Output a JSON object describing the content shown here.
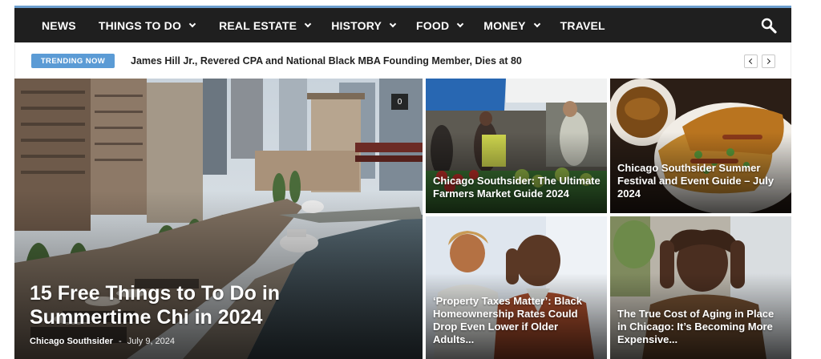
{
  "nav": {
    "items": [
      {
        "label": "NEWS",
        "dropdown": false
      },
      {
        "label": "THINGS TO DO",
        "dropdown": true
      },
      {
        "label": "REAL ESTATE",
        "dropdown": true
      },
      {
        "label": "HISTORY",
        "dropdown": true
      },
      {
        "label": "FOOD",
        "dropdown": true
      },
      {
        "label": "MONEY",
        "dropdown": true
      },
      {
        "label": "TRAVEL",
        "dropdown": false
      }
    ],
    "search_icon": "search-icon",
    "background": "#1f1f1f",
    "accent": "#6d9fcf"
  },
  "trending": {
    "badge": "TRENDING NOW",
    "headline": "James Hill Jr., Revered CPA and National Black MBA Founding Member, Dies at 80",
    "badge_color": "#5b9bd5"
  },
  "featured": {
    "title": "15 Free Things to To Do in Summertime Chi in 2024",
    "author": "Chicago Southsider",
    "separator": "-",
    "date": "July 9, 2024",
    "comment_count": "0"
  },
  "tiles": [
    {
      "title": "Chicago Southsider: The Ultimate Farmers Market Guide 2024"
    },
    {
      "title": "Chicago Southsider Summer Festival and Event Guide – July 2024"
    },
    {
      "title": "‘Property Taxes Matter’: Black Homeownership Rates Could Drop Even Lower if Older Adults..."
    },
    {
      "title": "The True Cost of Aging in Place in Chicago: It’s Becoming More Expensive..."
    }
  ]
}
